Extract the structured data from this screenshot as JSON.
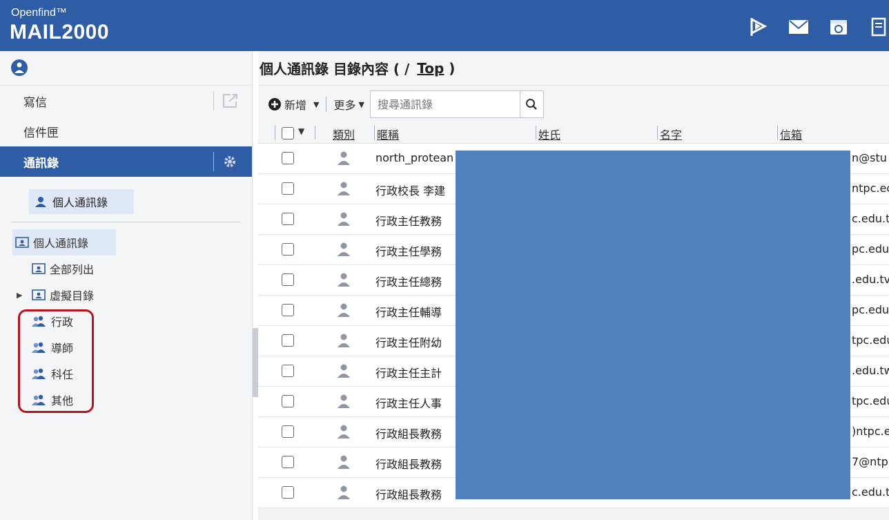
{
  "brand": {
    "small": "Openfind™",
    "big": "MAIL2000"
  },
  "header_icons": [
    "flag-icon",
    "mail-icon",
    "calendar-icon",
    "notes-icon"
  ],
  "nav": {
    "items": [
      {
        "label": "寫信"
      },
      {
        "label": "信件匣"
      },
      {
        "label": "通訊錄",
        "active": true
      }
    ]
  },
  "left": {
    "addr_button": "個人通訊錄",
    "tree_root": "個人通訊錄",
    "tree_children": [
      "全部列出",
      "虛擬目錄"
    ],
    "groups": [
      "行政",
      "導師",
      "科任",
      "其他"
    ]
  },
  "right": {
    "breadcrumb_prefix": "個人通訊錄 目錄內容 ( / ",
    "breadcrumb_link": "Top",
    "breadcrumb_suffix": " )",
    "toolbar": {
      "add_label": "新增",
      "more_label": "更多"
    },
    "search": {
      "placeholder": "搜尋通訊錄"
    },
    "columns": [
      "類別",
      "暱稱",
      "姓氏",
      "名字",
      "信箱"
    ],
    "rows": [
      {
        "nick": "north_protean",
        "mail": "n@stu"
      },
      {
        "nick": "行政校長 李建",
        "mail": "ntpc.ec"
      },
      {
        "nick": "行政主任教務",
        "mail": "c.edu.t"
      },
      {
        "nick": "行政主任學務",
        "mail": "pc.edu."
      },
      {
        "nick": "行政主任總務",
        "mail": ".edu.tv"
      },
      {
        "nick": "行政主任輔導",
        "mail": "pc.edu."
      },
      {
        "nick": "行政主任附幼",
        "mail": "tpc.edu"
      },
      {
        "nick": "行政主任主計",
        "mail": ".edu.tw"
      },
      {
        "nick": "行政主任人事",
        "mail": "tpc.edu"
      },
      {
        "nick": "行政組長教務",
        "mail": ")ntpc.e"
      },
      {
        "nick": "行政組長教務",
        "mail": "7@ntp"
      },
      {
        "nick": "行政組長教務",
        "mail": "c.edu.t"
      }
    ]
  },
  "colors": {
    "brand_blue": "#2f5da5",
    "redaction": "#4f81bd",
    "highlight_red": "#b8141e"
  }
}
